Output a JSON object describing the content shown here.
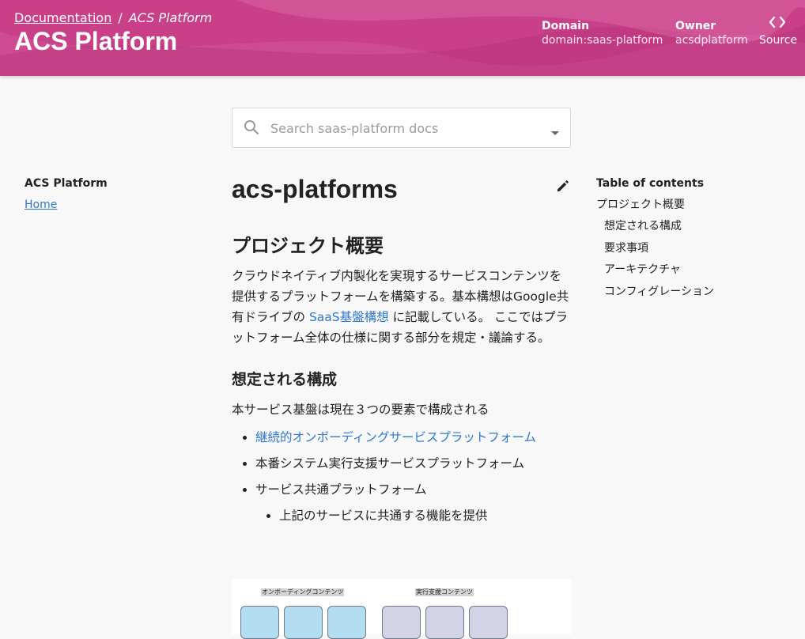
{
  "header": {
    "breadcrumb_root": "Documentation",
    "breadcrumb_sep": "/",
    "breadcrumb_current": "ACS Platform",
    "title": "ACS Platform",
    "domain_label": "Domain",
    "domain_value": "domain:saas-platform",
    "owner_label": "Owner",
    "owner_value": "acsdplatform",
    "source_label": "Source"
  },
  "search": {
    "placeholder": "Search saas-platform docs"
  },
  "nav": {
    "title": "ACS Platform",
    "home": "Home"
  },
  "doc": {
    "title": "acs-platforms",
    "h1": "プロジェクト概要",
    "intro_before_link": "クラウドネイティブ内製化を実現するサービスコンテンツを提供するプラットフォームを構築する。基本構想はGoogle共有ドライブの ",
    "intro_link": "SaaS基盤構想",
    "intro_after_link": " に記載している。 ここではプラットフォーム全体の仕様に関する部分を規定・議論する。",
    "h2": "想定される構成",
    "lead": "本サービス基盤は現在３つの要素で構成される",
    "bullets": [
      "継続的オンボーディングサービスプラットフォーム",
      "本番システム実行支援サービスプラットフォーム",
      "サービス共通プラットフォーム"
    ],
    "sub_bullet": "上記のサービスに共通する機能を提供",
    "diagram_label_left": "オンボーディングコンテンツ",
    "diagram_label_right": "実行支援コンテンツ"
  },
  "toc": {
    "title": "Table of contents",
    "items": [
      "プロジェクト概要",
      "想定される構成",
      "要求事項",
      "アーキテクチャ",
      "コンフィグレーション"
    ]
  },
  "colors": {
    "header_bg": "#c93f88",
    "link": "#2e77d0",
    "page_bg": "#f8f8f8"
  }
}
